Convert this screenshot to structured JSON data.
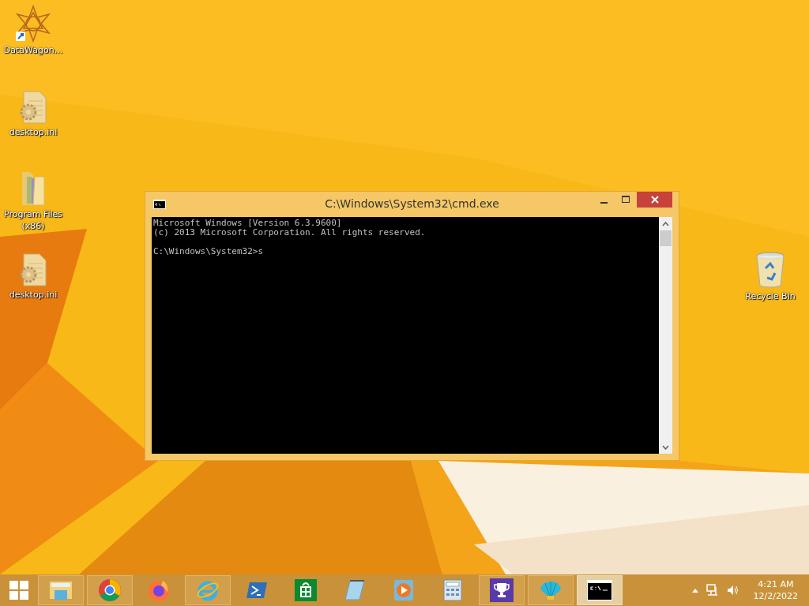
{
  "desktop_icons": [
    {
      "kind": "shortcut-star",
      "label": "DataWagon..."
    },
    {
      "kind": "settings-file",
      "label": "desktop.ini"
    },
    {
      "kind": "folder",
      "label": "Program Files (x86)"
    },
    {
      "kind": "settings-file",
      "label": "desktop.ini"
    },
    {
      "kind": "recycle-bin",
      "label": "Recycle Bin"
    }
  ],
  "window": {
    "title": "C:\\Windows\\System32\\cmd.exe",
    "console_lines": [
      "Microsoft Windows [Version 6.3.9600]",
      "(c) 2013 Microsoft Corporation. All rights reserved."
    ],
    "prompt_line": "C:\\Windows\\System32>s"
  },
  "taskbar": {
    "apps": [
      {
        "kind": "explorer",
        "running": true,
        "selected": false
      },
      {
        "kind": "chrome",
        "running": true,
        "selected": false
      },
      {
        "kind": "firefox",
        "running": false,
        "selected": false
      },
      {
        "kind": "ie",
        "running": true,
        "selected": false
      },
      {
        "kind": "powershell",
        "running": false,
        "selected": false
      },
      {
        "kind": "store",
        "running": false,
        "selected": false
      },
      {
        "kind": "notepad",
        "running": false,
        "selected": false
      },
      {
        "kind": "media",
        "running": false,
        "selected": false
      },
      {
        "kind": "calculator",
        "running": false,
        "selected": false
      },
      {
        "kind": "trophy",
        "running": true,
        "selected": false
      },
      {
        "kind": "shell",
        "running": true,
        "selected": false
      },
      {
        "kind": "cmd",
        "running": true,
        "selected": true
      }
    ],
    "clock": {
      "time": "4:21 AM",
      "date": "12/2/2022"
    }
  }
}
